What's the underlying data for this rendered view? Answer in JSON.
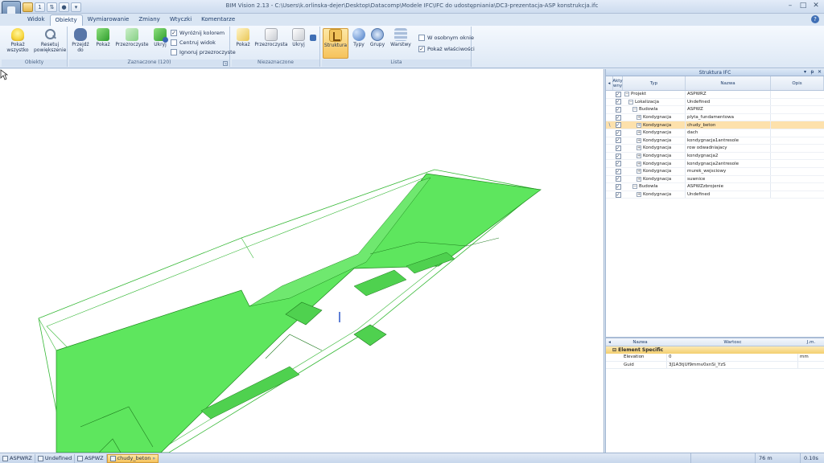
{
  "app": {
    "title": "BIM Vision 2.13 - C:\\Users\\k.orlinska-dejer\\Desktop\\Datacomp\\Modele IFC\\IFC do udostępniania\\DC3-prezentacja-ASP konstrukcja.ifc",
    "qat_number": "1"
  },
  "tabs": [
    {
      "label": "Widok"
    },
    {
      "label": "Obiekty"
    },
    {
      "label": "Wymiarowanie"
    },
    {
      "label": "Zmiany"
    },
    {
      "label": "Wtyczki"
    },
    {
      "label": "Komentarze"
    }
  ],
  "ribbon": {
    "obiekty": {
      "label": "Obiekty",
      "show_all": "Pokaż wszystko",
      "reset_zoom": "Resetuj powiększenie"
    },
    "zaznaczone": {
      "label": "Zaznaczone (120)",
      "goto": "Przejdź do",
      "show": "Pokaż",
      "transparent": "Przezroczyste",
      "hide": "Ukryj",
      "highlight_color": "Wyróżnij kolorem",
      "center_view": "Centruj widok",
      "ignore_transparent": "Ignoruj przezroczyste"
    },
    "niezaznaczone": {
      "label": "Niezaznaczone",
      "show": "Pokaż",
      "transparent": "Przezroczysta",
      "hide": "Ukryj"
    },
    "lista": {
      "label": "Lista",
      "structure": "Struktura",
      "types": "Typy",
      "groups": "Grupy",
      "layers": "Warstwy",
      "separate_window": "W osobnym oknie",
      "show_properties": "Pokaż właściwości"
    }
  },
  "struct_panel": {
    "title": "Struktura IFC",
    "col_active": "Akty wny",
    "col_type": "Typ",
    "col_name": "Nazwa",
    "col_desc": "Opis",
    "rows": [
      {
        "type": "Projekt",
        "name": "ASPWRZ",
        "selected": false,
        "marker": ""
      },
      {
        "type": "Lokalizacja",
        "name": "Undefined",
        "selected": false,
        "marker": ""
      },
      {
        "type": "Budowla",
        "name": "ASPWZ",
        "selected": false,
        "marker": ""
      },
      {
        "type": "Kondygnacja",
        "name": "plyta_fundamentowa",
        "selected": false,
        "marker": ""
      },
      {
        "type": "Kondygnacja",
        "name": "chudy_beton",
        "selected": true,
        "marker": "\\"
      },
      {
        "type": "Kondygnacja",
        "name": "dach",
        "selected": false,
        "marker": ""
      },
      {
        "type": "Kondygnacja",
        "name": "kondygnacja1antresole",
        "selected": false,
        "marker": ""
      },
      {
        "type": "Kondygnacja",
        "name": "row odwadniajacy",
        "selected": false,
        "marker": ""
      },
      {
        "type": "Kondygnacja",
        "name": "kondygnacja2",
        "selected": false,
        "marker": ""
      },
      {
        "type": "Kondygnacja",
        "name": "kondygnacja2antresole",
        "selected": false,
        "marker": ""
      },
      {
        "type": "Kondygnacja",
        "name": "murek_wejsciowy",
        "selected": false,
        "marker": ""
      },
      {
        "type": "Kondygnacja",
        "name": "suwnice",
        "selected": false,
        "marker": ""
      },
      {
        "type": "Budowla",
        "name": "ASPWZzbrojenie",
        "selected": false,
        "marker": ""
      },
      {
        "type": "Kondygnacja",
        "name": "Undefined",
        "selected": false,
        "marker": ""
      }
    ]
  },
  "props_panel": {
    "col_name": "Nazwa",
    "col_value": "Wartosc",
    "col_unit": "J.m.",
    "category": "Element Specific",
    "rows": [
      {
        "name": "Elevation",
        "value": "0",
        "unit": "mm"
      },
      {
        "name": "Guid",
        "value": "3J1A3tjUf9mmv0xnSi_YzS",
        "unit": ""
      }
    ]
  },
  "statusbar": {
    "crumbs": [
      "ASPWRZ",
      "Undefined",
      "ASPWZ",
      "chudy_beton"
    ],
    "distance": "76 m",
    "time": "0.10s"
  },
  "colors": {
    "model_fill": "#5ee65e",
    "model_stroke": "#1e8a1e",
    "selected_row": "#fde1ac"
  }
}
